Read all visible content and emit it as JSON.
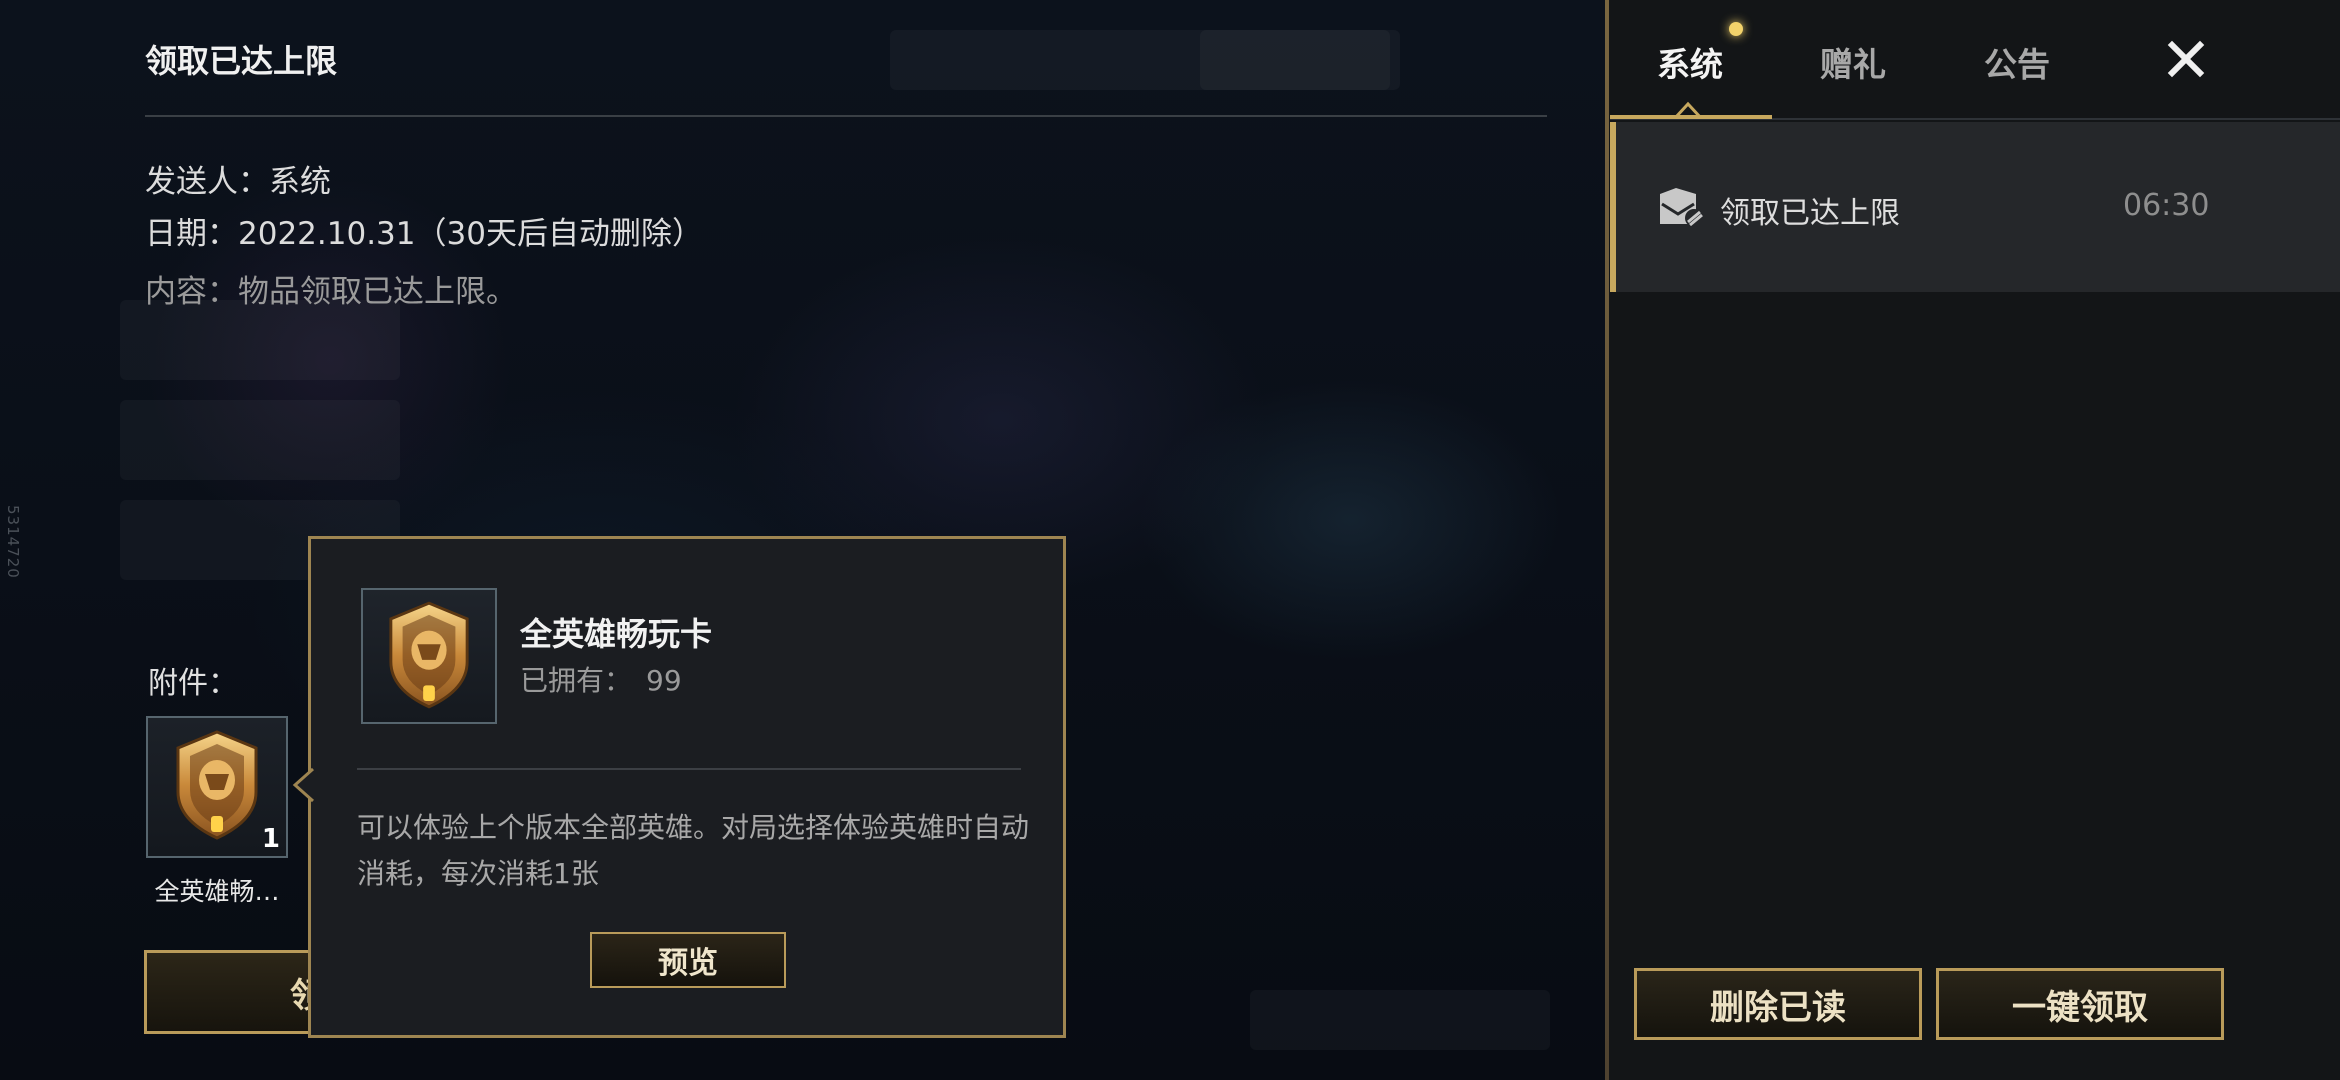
{
  "mail_detail": {
    "title": "领取已达上限",
    "sender": "发送人：系统",
    "date": "日期：2022.10.31（30天后自动删除）",
    "content": "内容：物品领取已达上限。",
    "attachments_label": "附件：",
    "attachment": {
      "name": "全英雄畅…",
      "count": "1",
      "icon": "all-heroes-card-shield-icon"
    },
    "claim_button": "领取"
  },
  "tooltip": {
    "name": "全英雄畅玩卡",
    "owned_label": "已拥有：",
    "owned_value": "99",
    "description": "可以体验上个版本全部英雄。对局选择体验英雄时自动消耗，每次消耗1张",
    "preview_button": "预览"
  },
  "side_panel": {
    "tabs": [
      {
        "label": "系统",
        "active": true,
        "has_notification": true
      },
      {
        "label": "赠礼",
        "active": false
      },
      {
        "label": "公告",
        "active": false
      }
    ],
    "close_icon": "close-icon",
    "mail_list": [
      {
        "subject": "领取已达上限",
        "time": "06:30",
        "icon": "mail-read-icon",
        "selected": true
      }
    ],
    "delete_read_button": "删除已读",
    "claim_all_button": "一键领取"
  },
  "watermark": "5314720",
  "colors": {
    "gold_accent": "#c7a85e",
    "notification_dot": "#f3d36b",
    "panel_bg": "#131517",
    "selected_row_bg": "#25272a"
  }
}
